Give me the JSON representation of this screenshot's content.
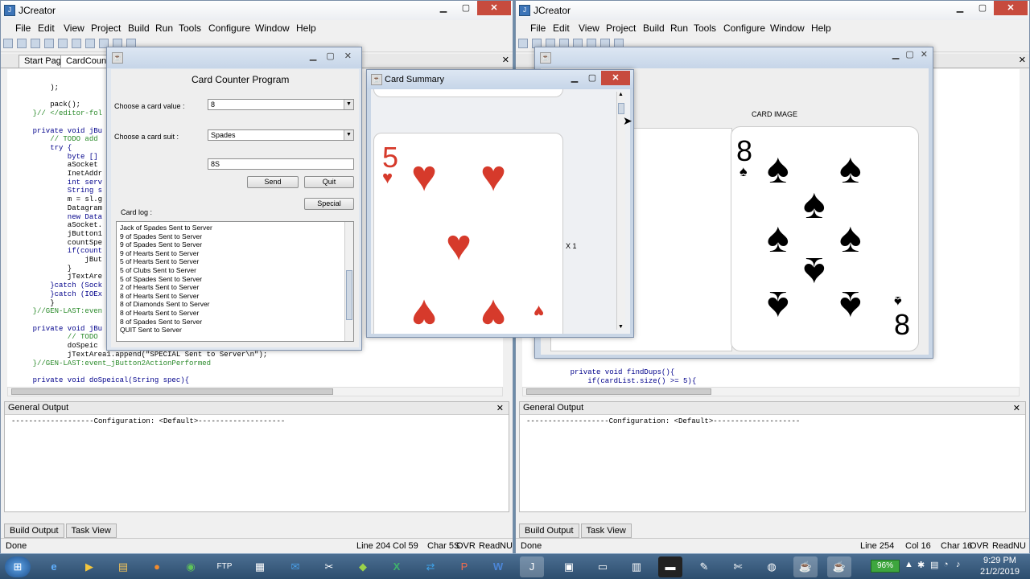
{
  "app": {
    "title": "JCreator",
    "menu": [
      "File",
      "Edit",
      "View",
      "Project",
      "Build",
      "Run",
      "Tools",
      "Configure",
      "Window",
      "Help"
    ]
  },
  "left": {
    "tabs": [
      "Start Page",
      "CardCounte"
    ],
    "code_lines": [
      "        );",
      "",
      "        pack();",
      "    }// </editor-fol",
      "",
      "    private void jBu",
      "        // TODO add",
      "        try {",
      "            byte []",
      "            aSocket",
      "            InetAddr",
      "            int serv",
      "            String s",
      "            m = sl.g",
      "            Datagram",
      "            new Data",
      "            aSocket.",
      "            jButton1",
      "            countSpe",
      "            if(count",
      "                jBut",
      "            }",
      "            jTextAre",
      "        }catch (Sock",
      "        }catch (IOEx",
      "        }",
      "    }//GEN-LAST:even",
      "",
      "    private void jBu",
      "            // TODO",
      "            doSpeic",
      "            jTextArea1.append(\"SPECIAL Sent to Server\\n\");",
      "    }//GEN-LAST:event_jButton2ActionPerformed",
      "",
      "    private void doSpeical(String spec){"
    ],
    "output_title": "General Output",
    "output_text": "-------------------Configuration: <Default>--------------------",
    "bottom_tabs": [
      "Build Output",
      "Task View"
    ],
    "status": {
      "state": "Done",
      "line": "Line 204",
      "col": "Col 59",
      "char": "Char 5S",
      "ovr": "OVR",
      "read": "Read",
      "num": "NU"
    }
  },
  "right": {
    "code_lines": [
      "    private void findDups(){",
      "        if(cardList.size() >= 5){"
    ],
    "output_title": "General Output",
    "output_text": "-------------------Configuration: <Default>--------------------",
    "bottom_tabs": [
      "Build Output",
      "Task View"
    ],
    "status": {
      "state": "Done",
      "line": "Line 254",
      "col": "Col 16",
      "char": "Char 16",
      "ovr": "OVR",
      "read": "Read",
      "num": "NU"
    },
    "card_image_title": "CARD IMAGE",
    "card_rank": "8"
  },
  "card_counter": {
    "heading": "Card Counter Program",
    "value_label": "Choose a card value :",
    "value_selected": "8",
    "suit_label": "Choose a card suit :",
    "suit_selected": "Spades",
    "text_field": "8S",
    "send": "Send",
    "quit": "Quit",
    "special": "Special",
    "log_label": "Card log :",
    "log": [
      "Jack of Spades Sent to Server",
      "9 of Spades Sent to Server",
      "9 of Spades Sent to Server",
      "9 of Hearts Sent to Server",
      "5 of Hearts Sent to Server",
      "5 of Clubs Sent to Server",
      "5 of Spades Sent to Server",
      "2 of Hearts Sent to Server",
      "8 of Hearts Sent to Server",
      "8 of Diamonds Sent to Server",
      "8 of Hearts Sent to Server",
      "8 of Spades Sent to Server",
      "QUIT Sent to Server"
    ]
  },
  "card_summary": {
    "title": "Card Summary",
    "rank": "5",
    "count": "X 1"
  },
  "taskbar": {
    "battery": "96%",
    "time": "9:29 PM",
    "date": "21/2/2019",
    "ftp": "FTP"
  }
}
